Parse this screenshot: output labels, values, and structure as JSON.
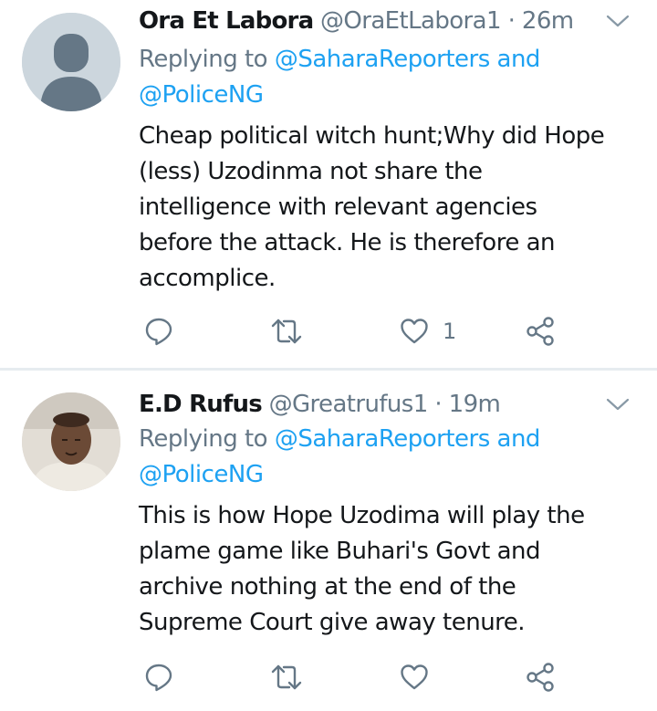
{
  "tweets": [
    {
      "display_name": "Ora Et Labora",
      "handle": "@OraEtLabora1",
      "separator": "·",
      "time": "26m",
      "replying_prefix": "Replying to ",
      "replying_mention_1": "@SaharaReporters",
      "replying_and": " and",
      "replying_mention_2": "@PoliceNG",
      "text_lines": [
        "Cheap political witch hunt;Why did Hope",
        "(less) Uzodinma not share the",
        "intelligence with relevant agencies",
        "before the attack. He is therefore an",
        "accomplice."
      ],
      "like_count": "1",
      "avatar": "default-avatar"
    },
    {
      "display_name": "E.D Rufus",
      "handle": "@Greatrufus1",
      "separator": "·",
      "time": "19m",
      "replying_prefix": "Replying to ",
      "replying_mention_1": "@SaharaReporters",
      "replying_and": " and",
      "replying_mention_2": "@PoliceNG",
      "text_lines": [
        "This is how Hope Uzodima will play the",
        "plame game like Buhari's Govt and",
        "archive nothing at the end of the",
        "Supreme Court give away tenure."
      ],
      "like_count": "",
      "avatar": "user-photo"
    }
  ],
  "colors": {
    "text": "#14171a",
    "secondary": "#657786",
    "link": "#1da1f2",
    "divider": "#e6ecf0",
    "default_avatar_bg": "#ccd6dd",
    "default_avatar_fg": "#657786"
  },
  "icons": [
    "reply-icon",
    "retweet-icon",
    "like-icon",
    "share-icon",
    "chevron-down-icon"
  ]
}
